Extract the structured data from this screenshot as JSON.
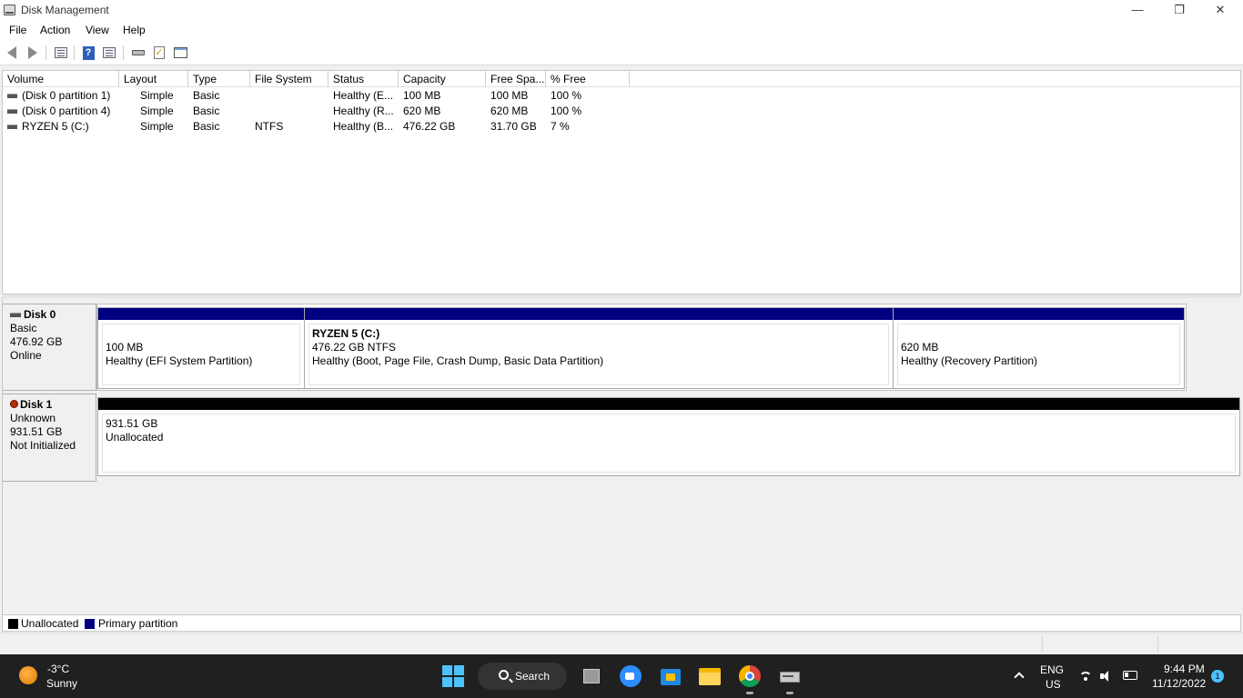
{
  "window": {
    "title": "Disk Management",
    "controls": {
      "minimize": "—",
      "restore": "❐",
      "close": "✕"
    }
  },
  "menu": [
    "File",
    "Action",
    "View",
    "Help"
  ],
  "toolbar": {
    "icons": [
      "back-icon",
      "forward-icon",
      "properties-icon",
      "help-icon",
      "console-tree-icon",
      "connect-disk-icon",
      "check-icon",
      "window-icon"
    ]
  },
  "volume_list": {
    "columns": [
      "Volume",
      "Layout",
      "Type",
      "File System",
      "Status",
      "Capacity",
      "Free Spa...",
      "% Free"
    ],
    "rows": [
      [
        "(Disk 0 partition 1)",
        "Simple",
        "Basic",
        "",
        "Healthy (E...",
        "100 MB",
        "100 MB",
        "100 %"
      ],
      [
        "(Disk 0 partition 4)",
        "Simple",
        "Basic",
        "",
        "Healthy (R...",
        "620 MB",
        "620 MB",
        "100 %"
      ],
      [
        "RYZEN 5 (C:)",
        "Simple",
        "Basic",
        "NTFS",
        "Healthy (B...",
        "476.22 GB",
        "31.70 GB",
        "7 %"
      ]
    ]
  },
  "disks": [
    {
      "name": "Disk 0",
      "type": "Basic",
      "size": "476.92 GB",
      "state": "Online",
      "partitions": [
        {
          "name": "",
          "size": "100 MB",
          "status": "Healthy (EFI System Partition)"
        },
        {
          "name": "RYZEN 5  (C:)",
          "size": "476.22 GB NTFS",
          "status": "Healthy (Boot, Page File, Crash Dump, Basic Data Partition)"
        },
        {
          "name": "",
          "size": "620 MB",
          "status": "Healthy (Recovery Partition)"
        }
      ]
    },
    {
      "name": "Disk 1",
      "type": "Unknown",
      "size": "931.51 GB",
      "state": "Not Initialized",
      "partitions": [
        {
          "name": "",
          "size": "931.51 GB",
          "status": "Unallocated"
        }
      ]
    }
  ],
  "legend": [
    {
      "label": "Unallocated",
      "color": "#000000"
    },
    {
      "label": "Primary partition",
      "color": "#000080"
    }
  ],
  "colors": {
    "primary": "#000080",
    "unallocated": "#000000",
    "taskbar": "#202020",
    "accent": "#4cc2ff"
  },
  "taskbar": {
    "weather": {
      "temp": "-3°C",
      "desc": "Sunny"
    },
    "search_label": "Search",
    "apps": [
      "start-icon",
      "search",
      "task-view-icon",
      "zoom-icon",
      "store-icon",
      "file-explorer-icon",
      "chrome-icon",
      "disk-management-icon"
    ],
    "tray": {
      "lang": "ENG",
      "region": "US",
      "time": "9:44 PM",
      "date": "11/12/2022",
      "notifications": "1"
    }
  }
}
